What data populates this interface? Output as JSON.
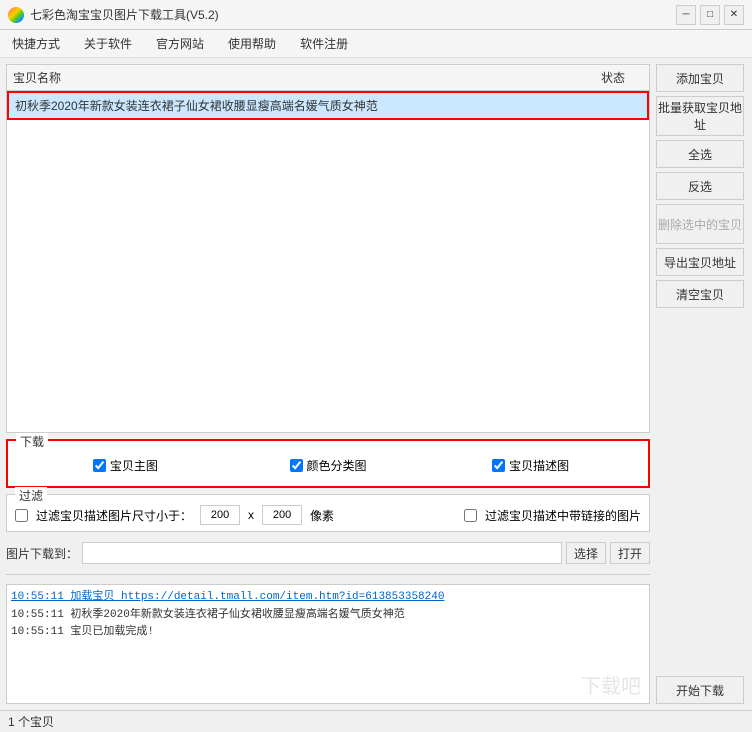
{
  "titlebar": {
    "title": "七彩色淘宝宝贝图片下载工具(V5.2)",
    "min_label": "─",
    "max_label": "□",
    "close_label": "✕"
  },
  "menu": {
    "items": [
      "快捷方式",
      "关于软件",
      "官方网站",
      "使用帮助",
      "软件注册"
    ]
  },
  "product_table": {
    "col_name": "宝贝名称",
    "col_status": "状态",
    "row": {
      "name": "初秋季2020年新款女装连衣裙子仙女裙收腰显瘦高端名媛气质女神范",
      "status": ""
    }
  },
  "buttons": {
    "add": "添加宝贝",
    "batch_get": "批量获取宝贝地址",
    "select_all": "全选",
    "deselect": "反选",
    "delete_selected": "删除选中的宝贝",
    "export": "导出宝贝地址",
    "clear": "清空宝贝",
    "start_download": "开始下载"
  },
  "download_section": {
    "label": "下载",
    "checkbox_main": "宝贝主图",
    "checkbox_color": "颜色分类图",
    "checkbox_desc": "宝贝描述图",
    "main_checked": true,
    "color_checked": true,
    "desc_checked": true
  },
  "filter_section": {
    "label": "过滤",
    "filter1_label": "过滤宝贝描述图片尺寸小于：",
    "filter1_w": "200",
    "filter1_sep": "x",
    "filter1_h": "200",
    "filter1_unit": "像素",
    "filter2_label": "过滤宝贝描述中带链接的图片"
  },
  "path_section": {
    "label": "图片下载到：",
    "path_value": "",
    "btn_select": "选择",
    "btn_open": "打开"
  },
  "log": {
    "lines": [
      {
        "text": "10:55:11 加载宝贝 https://detail.tmall.com/item.htm?id=613853358240",
        "type": "link"
      },
      {
        "text": "10:55:11 初秋季2020年新款女装连衣裙子仙女裙收腰显瘦高端名媛气质女神范",
        "type": "normal"
      },
      {
        "text": "10:55:11 宝贝已加载完成!",
        "type": "normal"
      }
    ]
  },
  "statusbar": {
    "text": "1 个宝贝"
  },
  "watermark": {
    "text": "下载吧"
  }
}
